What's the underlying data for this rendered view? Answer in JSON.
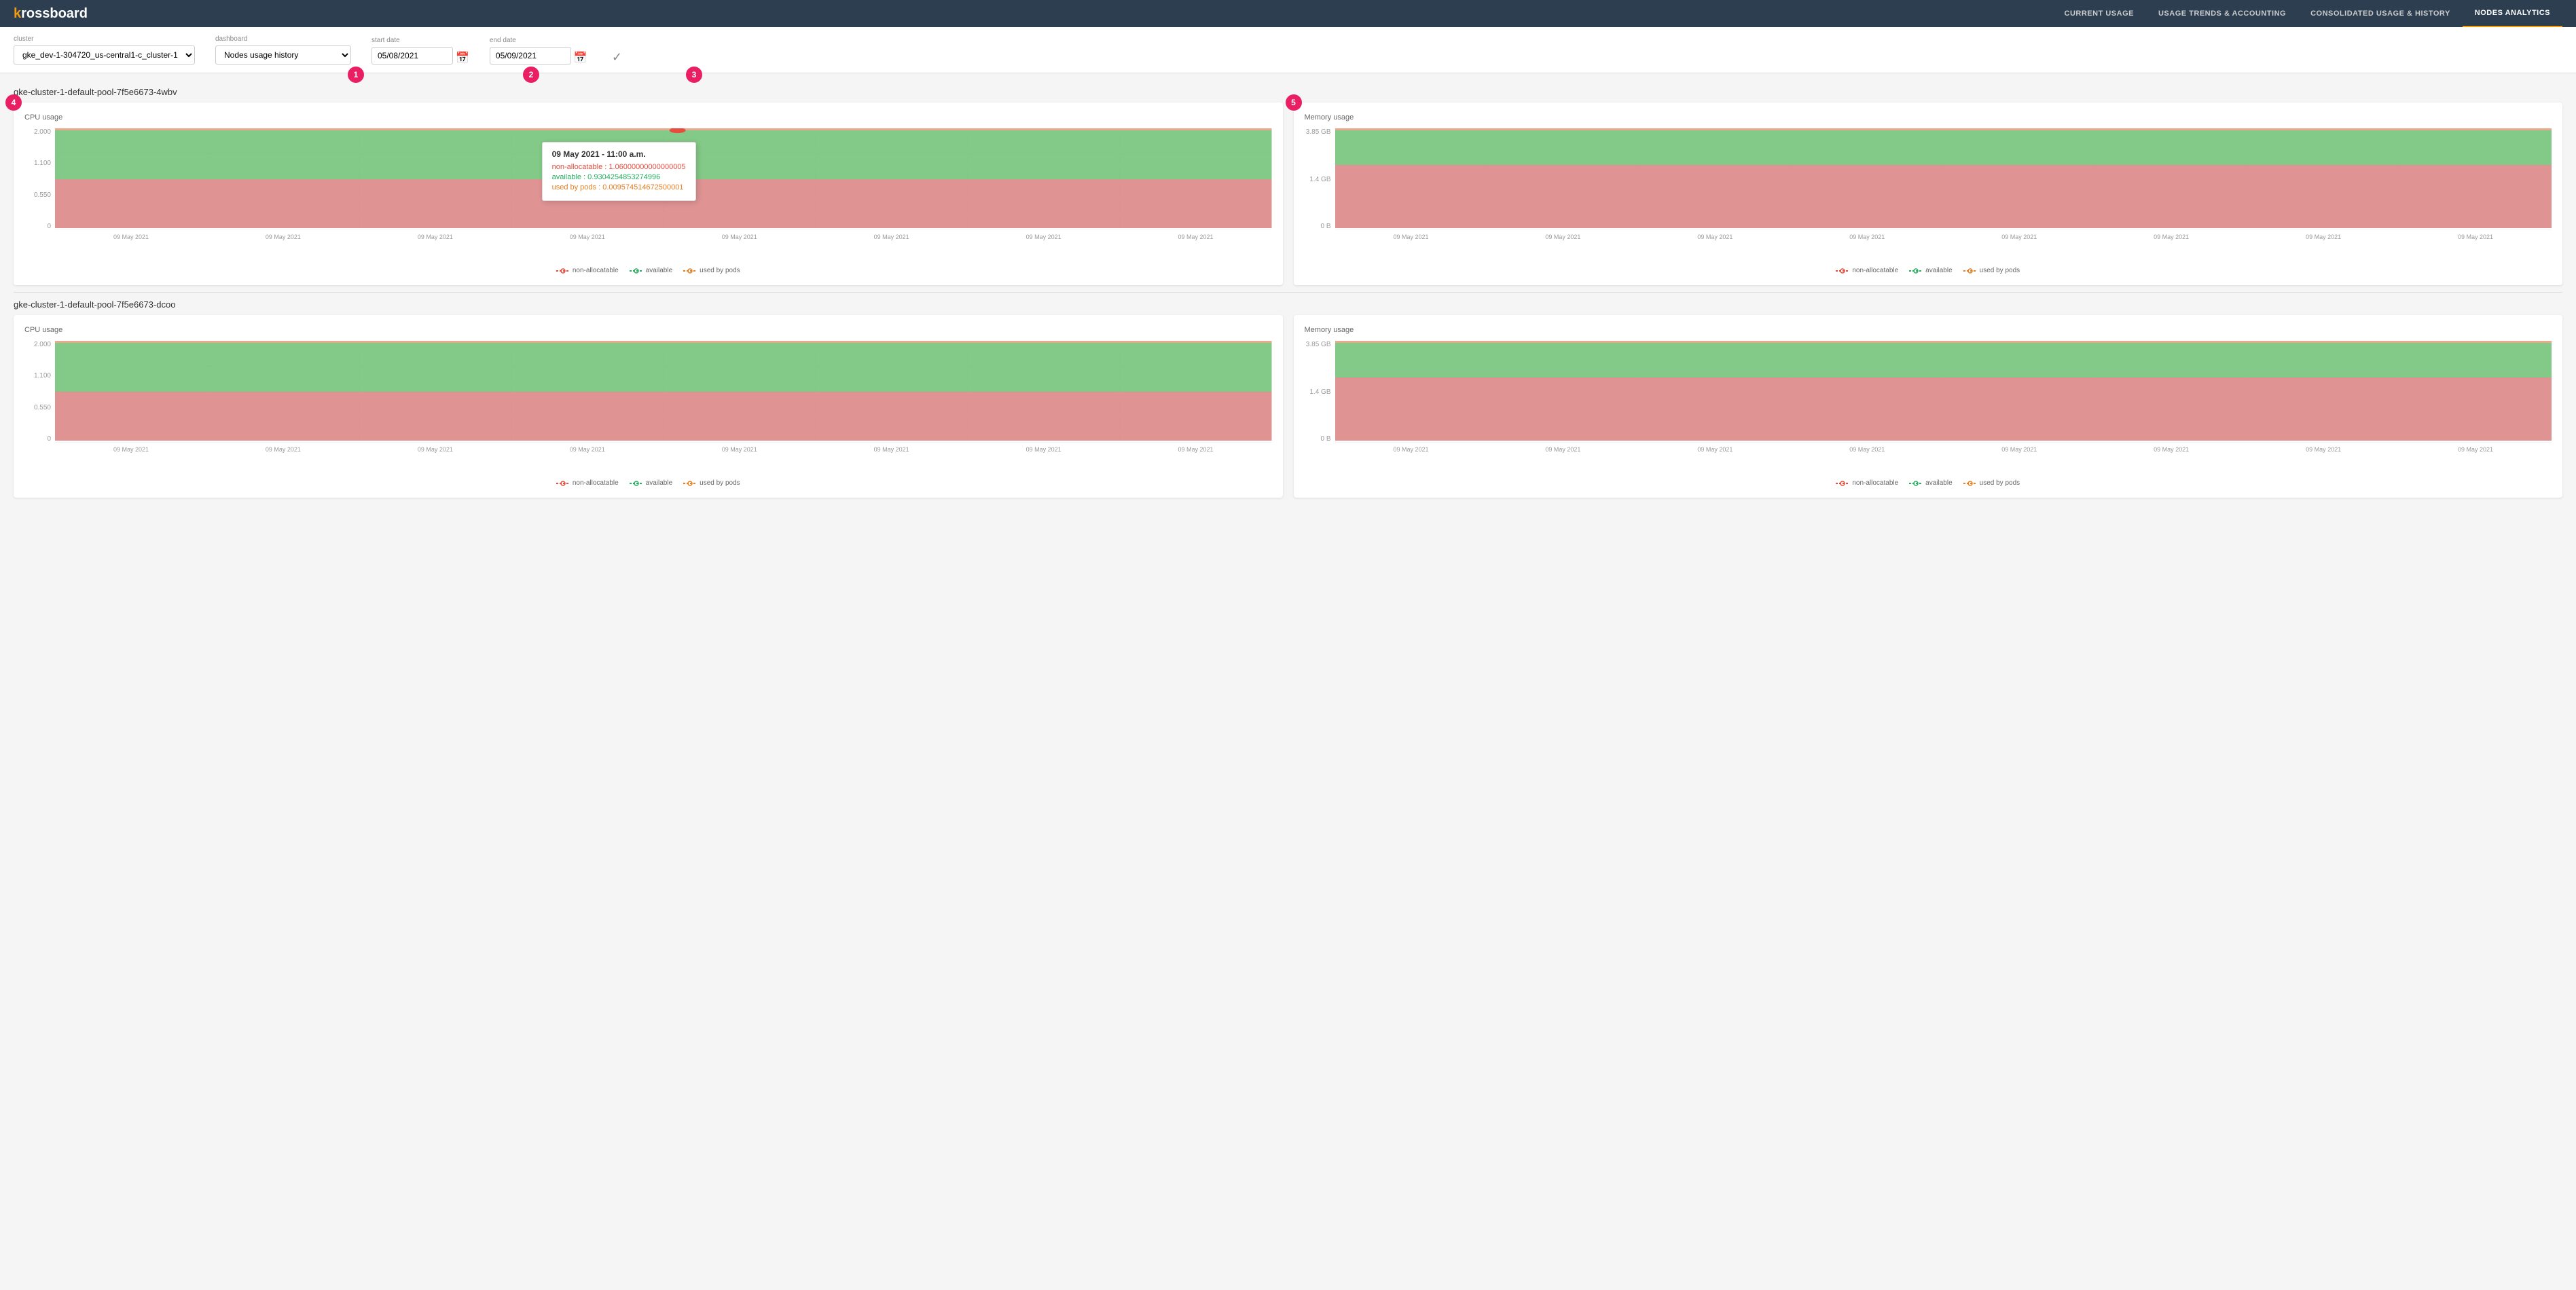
{
  "app": {
    "logo": "krossboard",
    "logo_k": "k"
  },
  "nav": {
    "links": [
      {
        "label": "CURRENT USAGE",
        "active": false
      },
      {
        "label": "USAGE TRENDS & ACCOUNTING",
        "active": false
      },
      {
        "label": "CONSOLIDATED USAGE & HISTORY",
        "active": false
      },
      {
        "label": "NODES ANALYTICS",
        "active": true
      }
    ]
  },
  "filters": {
    "cluster_label": "cluster",
    "cluster_value": "gke_dev-1-304720_us-central1-c_cluster-1",
    "dashboard_label": "dashboard",
    "dashboard_value": "Nodes usage history",
    "start_date_label": "start date",
    "start_date_value": "05/08/2021",
    "end_date_label": "end date",
    "end_date_value": "05/09/2021",
    "steps": [
      {
        "id": "1",
        "label": "1"
      },
      {
        "id": "2",
        "label": "2"
      },
      {
        "id": "3",
        "label": "3"
      }
    ]
  },
  "nodes": [
    {
      "id": "node-1",
      "title": "gke-cluster-1-default-pool-7f5e6673-4wbv",
      "cpu": {
        "title": "CPU usage",
        "y_labels": [
          "2.000",
          "1.100",
          "0.550",
          "0"
        ],
        "x_labels": [
          "09 May 2021",
          "09 May 2021",
          "09 May 2021",
          "09 May 2021",
          "09 May 2021",
          "09 May 2021",
          "09 May 2021",
          "09 May 2021"
        ],
        "has_tooltip": true,
        "tooltip": {
          "title": "09 May 2021 - 11:00 a.m.",
          "non_allocatable": "non-allocatable : 1.06000000000000005",
          "available": "available : 0.9304254853274996",
          "used_by_pods": "used by pods : 0.009574514672500001"
        }
      },
      "memory": {
        "title": "Memory usage",
        "y_labels": [
          "3.85 GB",
          "1.4 GB",
          "0 B"
        ],
        "x_labels": [
          "09 May 2021",
          "09 May 2021",
          "09 May 2021",
          "09 May 2021",
          "09 May 2021",
          "09 May 2021",
          "09 May 2021",
          "09 May 2021"
        ]
      }
    },
    {
      "id": "node-2",
      "title": "gke-cluster-1-default-pool-7f5e6673-dcoo",
      "cpu": {
        "title": "CPU usage",
        "y_labels": [
          "2.000",
          "1.100",
          "0.550",
          "0"
        ],
        "x_labels": [
          "09 May 2021",
          "09 May 2021",
          "09 May 2021",
          "09 May 2021",
          "09 May 2021",
          "09 May 2021",
          "09 May 2021",
          "09 May 2021"
        ],
        "has_tooltip": false
      },
      "memory": {
        "title": "Memory usage",
        "y_labels": [
          "3.85 GB",
          "1.4 GB",
          "0 B"
        ],
        "x_labels": [
          "09 May 2021",
          "09 May 2021",
          "09 May 2021",
          "09 May 2021",
          "09 May 2021",
          "09 May 2021",
          "09 May 2021",
          "09 May 2021"
        ]
      }
    }
  ],
  "legend": {
    "non_allocatable": "non-allocatable",
    "available": "available",
    "used_by_pods": "used by pods"
  },
  "colors": {
    "green": "#6dbf72",
    "pink": "#d98080",
    "red_dot": "#e74c3c",
    "green_dot": "#27ae60",
    "orange_dot": "#e67e22",
    "nav_bg": "#2c3e50",
    "accent": "#f39c12",
    "badge": "#e91e63"
  }
}
